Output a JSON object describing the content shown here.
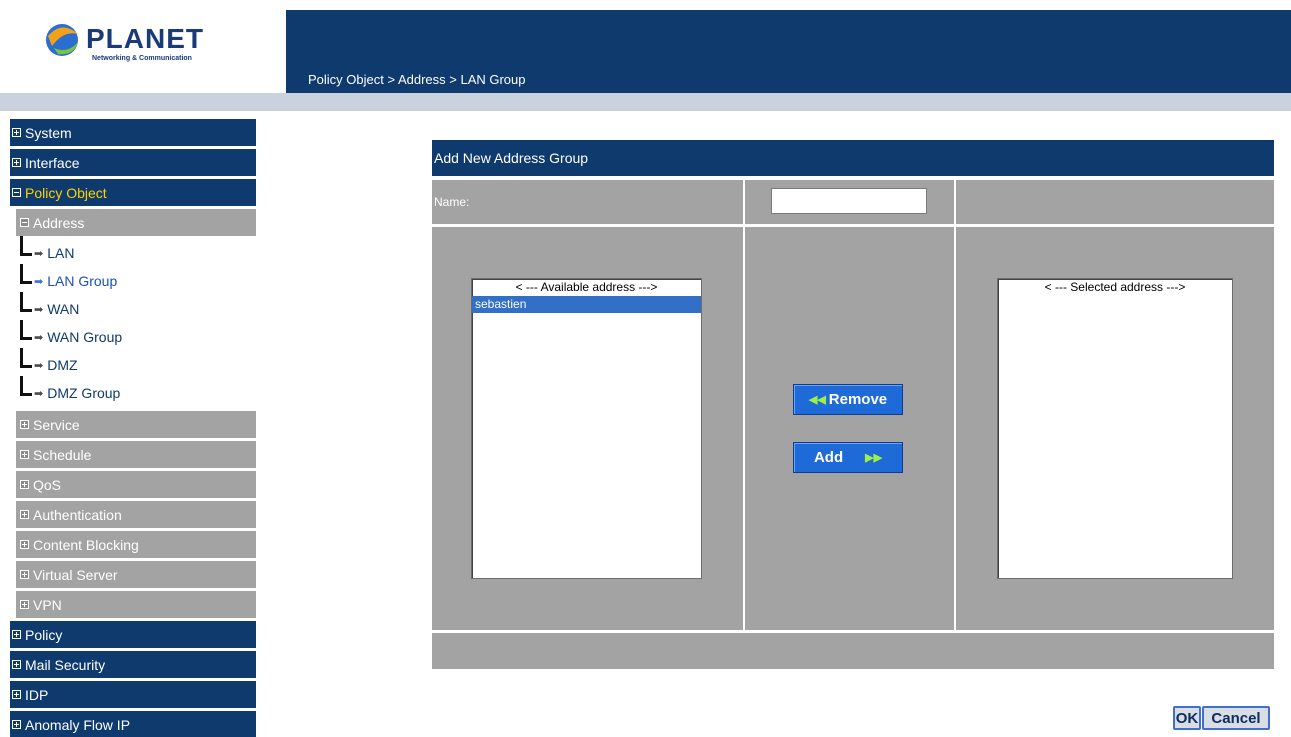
{
  "brand": {
    "name": "PLANET",
    "tagline": "Networking & Communication"
  },
  "breadcrumb": "Policy Object > Address > LAN Group",
  "sidebar": {
    "top_items": [
      {
        "label": "System"
      },
      {
        "label": "Interface"
      },
      {
        "label": "Policy Object",
        "active": true
      }
    ],
    "address_label": "Address",
    "address_children": [
      "LAN",
      "LAN Group",
      "WAN",
      "WAN Group",
      "DMZ",
      "DMZ Group"
    ],
    "sub_items": [
      "Service",
      "Schedule",
      "QoS",
      "Authentication",
      "Content Blocking",
      "Virtual Server",
      "VPN"
    ],
    "bottom_items": [
      "Policy",
      "Mail Security",
      "IDP",
      "Anomaly Flow IP"
    ]
  },
  "form": {
    "title": "Add New Address Group",
    "name_label": "Name:",
    "name_value": "",
    "available": {
      "header": "< --- Available address --->",
      "options": [
        "sebastien"
      ],
      "selected_option": "sebastien"
    },
    "selected": {
      "header": "< --- Selected address --->",
      "options": []
    },
    "remove_label": "Remove",
    "add_label": "Add"
  },
  "buttons": {
    "ok": "OK",
    "cancel": "Cancel"
  },
  "colors": {
    "navy": "#0e3a6e",
    "gray": "#a3a3a3",
    "active_text": "#ffd200",
    "button_blue": "#1f6ad9"
  }
}
